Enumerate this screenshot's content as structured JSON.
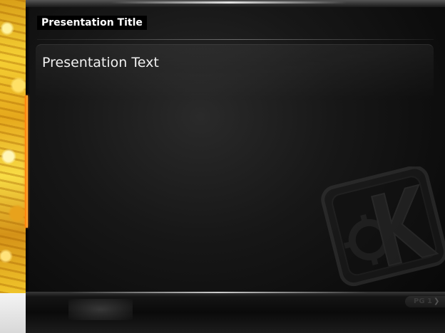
{
  "slide": {
    "title": "Presentation Title",
    "body_text": "Presentation Text",
    "page_label": "PG 1",
    "chevron": "❯"
  },
  "decorations": {
    "logo": "kde-logo",
    "accent_color": "#ff8a10",
    "strip_color": "#f0c42a",
    "background_color": "#0b0b0b"
  }
}
